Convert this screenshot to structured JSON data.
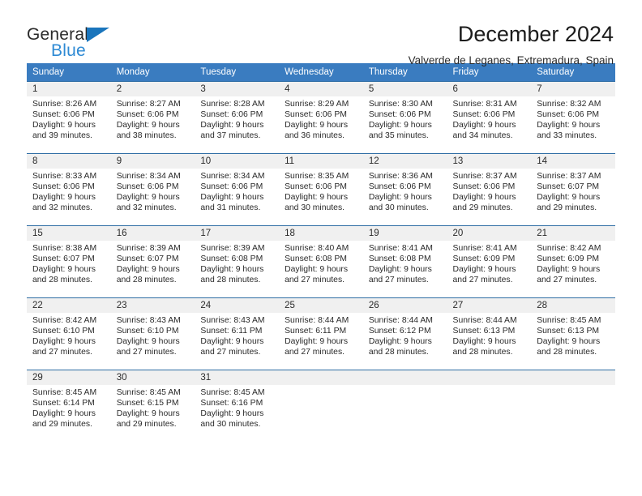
{
  "logo": {
    "word_top": "General",
    "word_bottom": "Blue",
    "triangle_color": "#1a75bc",
    "blue_text_color": "#2e8ad4"
  },
  "header": {
    "title": "December 2024",
    "subtitle": "Valverde de Leganes, Extremadura, Spain"
  },
  "theme": {
    "header_bg": "#3a7cc0",
    "row_border": "#2e6da4",
    "daynum_bg": "#f0f0f0",
    "text": "#2a2a2a"
  },
  "weekdays": [
    "Sunday",
    "Monday",
    "Tuesday",
    "Wednesday",
    "Thursday",
    "Friday",
    "Saturday"
  ],
  "labels": {
    "sunrise_prefix": "Sunrise: ",
    "sunset_prefix": "Sunset: ",
    "daylight_prefix": "Daylight: "
  },
  "weeks": [
    [
      {
        "day": "1",
        "sunrise": "Sunrise: 8:26 AM",
        "sunset": "Sunset: 6:06 PM",
        "daylight_line1": "Daylight: 9 hours",
        "daylight_line2": "and 39 minutes."
      },
      {
        "day": "2",
        "sunrise": "Sunrise: 8:27 AM",
        "sunset": "Sunset: 6:06 PM",
        "daylight_line1": "Daylight: 9 hours",
        "daylight_line2": "and 38 minutes."
      },
      {
        "day": "3",
        "sunrise": "Sunrise: 8:28 AM",
        "sunset": "Sunset: 6:06 PM",
        "daylight_line1": "Daylight: 9 hours",
        "daylight_line2": "and 37 minutes."
      },
      {
        "day": "4",
        "sunrise": "Sunrise: 8:29 AM",
        "sunset": "Sunset: 6:06 PM",
        "daylight_line1": "Daylight: 9 hours",
        "daylight_line2": "and 36 minutes."
      },
      {
        "day": "5",
        "sunrise": "Sunrise: 8:30 AM",
        "sunset": "Sunset: 6:06 PM",
        "daylight_line1": "Daylight: 9 hours",
        "daylight_line2": "and 35 minutes."
      },
      {
        "day": "6",
        "sunrise": "Sunrise: 8:31 AM",
        "sunset": "Sunset: 6:06 PM",
        "daylight_line1": "Daylight: 9 hours",
        "daylight_line2": "and 34 minutes."
      },
      {
        "day": "7",
        "sunrise": "Sunrise: 8:32 AM",
        "sunset": "Sunset: 6:06 PM",
        "daylight_line1": "Daylight: 9 hours",
        "daylight_line2": "and 33 minutes."
      }
    ],
    [
      {
        "day": "8",
        "sunrise": "Sunrise: 8:33 AM",
        "sunset": "Sunset: 6:06 PM",
        "daylight_line1": "Daylight: 9 hours",
        "daylight_line2": "and 32 minutes."
      },
      {
        "day": "9",
        "sunrise": "Sunrise: 8:34 AM",
        "sunset": "Sunset: 6:06 PM",
        "daylight_line1": "Daylight: 9 hours",
        "daylight_line2": "and 32 minutes."
      },
      {
        "day": "10",
        "sunrise": "Sunrise: 8:34 AM",
        "sunset": "Sunset: 6:06 PM",
        "daylight_line1": "Daylight: 9 hours",
        "daylight_line2": "and 31 minutes."
      },
      {
        "day": "11",
        "sunrise": "Sunrise: 8:35 AM",
        "sunset": "Sunset: 6:06 PM",
        "daylight_line1": "Daylight: 9 hours",
        "daylight_line2": "and 30 minutes."
      },
      {
        "day": "12",
        "sunrise": "Sunrise: 8:36 AM",
        "sunset": "Sunset: 6:06 PM",
        "daylight_line1": "Daylight: 9 hours",
        "daylight_line2": "and 30 minutes."
      },
      {
        "day": "13",
        "sunrise": "Sunrise: 8:37 AM",
        "sunset": "Sunset: 6:06 PM",
        "daylight_line1": "Daylight: 9 hours",
        "daylight_line2": "and 29 minutes."
      },
      {
        "day": "14",
        "sunrise": "Sunrise: 8:37 AM",
        "sunset": "Sunset: 6:07 PM",
        "daylight_line1": "Daylight: 9 hours",
        "daylight_line2": "and 29 minutes."
      }
    ],
    [
      {
        "day": "15",
        "sunrise": "Sunrise: 8:38 AM",
        "sunset": "Sunset: 6:07 PM",
        "daylight_line1": "Daylight: 9 hours",
        "daylight_line2": "and 28 minutes."
      },
      {
        "day": "16",
        "sunrise": "Sunrise: 8:39 AM",
        "sunset": "Sunset: 6:07 PM",
        "daylight_line1": "Daylight: 9 hours",
        "daylight_line2": "and 28 minutes."
      },
      {
        "day": "17",
        "sunrise": "Sunrise: 8:39 AM",
        "sunset": "Sunset: 6:08 PM",
        "daylight_line1": "Daylight: 9 hours",
        "daylight_line2": "and 28 minutes."
      },
      {
        "day": "18",
        "sunrise": "Sunrise: 8:40 AM",
        "sunset": "Sunset: 6:08 PM",
        "daylight_line1": "Daylight: 9 hours",
        "daylight_line2": "and 27 minutes."
      },
      {
        "day": "19",
        "sunrise": "Sunrise: 8:41 AM",
        "sunset": "Sunset: 6:08 PM",
        "daylight_line1": "Daylight: 9 hours",
        "daylight_line2": "and 27 minutes."
      },
      {
        "day": "20",
        "sunrise": "Sunrise: 8:41 AM",
        "sunset": "Sunset: 6:09 PM",
        "daylight_line1": "Daylight: 9 hours",
        "daylight_line2": "and 27 minutes."
      },
      {
        "day": "21",
        "sunrise": "Sunrise: 8:42 AM",
        "sunset": "Sunset: 6:09 PM",
        "daylight_line1": "Daylight: 9 hours",
        "daylight_line2": "and 27 minutes."
      }
    ],
    [
      {
        "day": "22",
        "sunrise": "Sunrise: 8:42 AM",
        "sunset": "Sunset: 6:10 PM",
        "daylight_line1": "Daylight: 9 hours",
        "daylight_line2": "and 27 minutes."
      },
      {
        "day": "23",
        "sunrise": "Sunrise: 8:43 AM",
        "sunset": "Sunset: 6:10 PM",
        "daylight_line1": "Daylight: 9 hours",
        "daylight_line2": "and 27 minutes."
      },
      {
        "day": "24",
        "sunrise": "Sunrise: 8:43 AM",
        "sunset": "Sunset: 6:11 PM",
        "daylight_line1": "Daylight: 9 hours",
        "daylight_line2": "and 27 minutes."
      },
      {
        "day": "25",
        "sunrise": "Sunrise: 8:44 AM",
        "sunset": "Sunset: 6:11 PM",
        "daylight_line1": "Daylight: 9 hours",
        "daylight_line2": "and 27 minutes."
      },
      {
        "day": "26",
        "sunrise": "Sunrise: 8:44 AM",
        "sunset": "Sunset: 6:12 PM",
        "daylight_line1": "Daylight: 9 hours",
        "daylight_line2": "and 28 minutes."
      },
      {
        "day": "27",
        "sunrise": "Sunrise: 8:44 AM",
        "sunset": "Sunset: 6:13 PM",
        "daylight_line1": "Daylight: 9 hours",
        "daylight_line2": "and 28 minutes."
      },
      {
        "day": "28",
        "sunrise": "Sunrise: 8:45 AM",
        "sunset": "Sunset: 6:13 PM",
        "daylight_line1": "Daylight: 9 hours",
        "daylight_line2": "and 28 minutes."
      }
    ],
    [
      {
        "day": "29",
        "sunrise": "Sunrise: 8:45 AM",
        "sunset": "Sunset: 6:14 PM",
        "daylight_line1": "Daylight: 9 hours",
        "daylight_line2": "and 29 minutes."
      },
      {
        "day": "30",
        "sunrise": "Sunrise: 8:45 AM",
        "sunset": "Sunset: 6:15 PM",
        "daylight_line1": "Daylight: 9 hours",
        "daylight_line2": "and 29 minutes."
      },
      {
        "day": "31",
        "sunrise": "Sunrise: 8:45 AM",
        "sunset": "Sunset: 6:16 PM",
        "daylight_line1": "Daylight: 9 hours",
        "daylight_line2": "and 30 minutes."
      },
      {
        "day": "",
        "sunrise": "",
        "sunset": "",
        "daylight_line1": "",
        "daylight_line2": ""
      },
      {
        "day": "",
        "sunrise": "",
        "sunset": "",
        "daylight_line1": "",
        "daylight_line2": ""
      },
      {
        "day": "",
        "sunrise": "",
        "sunset": "",
        "daylight_line1": "",
        "daylight_line2": ""
      },
      {
        "day": "",
        "sunrise": "",
        "sunset": "",
        "daylight_line1": "",
        "daylight_line2": ""
      }
    ]
  ]
}
